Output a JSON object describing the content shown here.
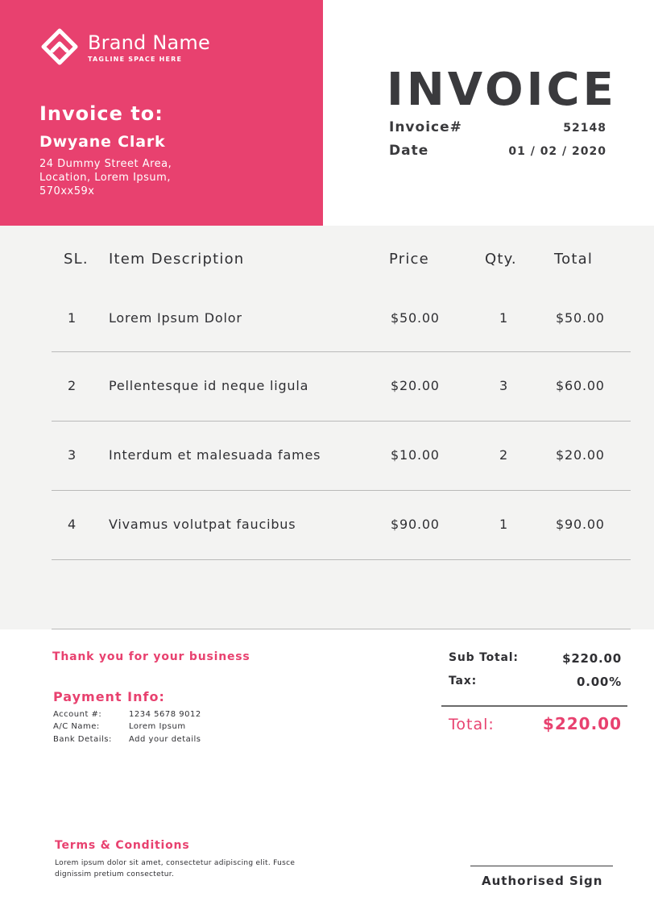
{
  "brand": {
    "name": "Brand Name",
    "tagline": "TAGLINE SPACE HERE"
  },
  "bill_to": {
    "label": "Invoice to:",
    "name": "Dwyane Clark",
    "address_lines": [
      "24 Dummy Street Area,",
      "Location, Lorem Ipsum,",
      "570xx59x"
    ]
  },
  "invoice": {
    "title": "INVOICE",
    "number_label": "Invoice#",
    "number": "52148",
    "date_label": "Date",
    "date": "01 / 02 / 2020"
  },
  "table": {
    "headers": {
      "sl": "SL.",
      "description": "Item Description",
      "price": "Price",
      "qty": "Qty.",
      "total": "Total"
    },
    "rows": [
      {
        "sl": "1",
        "description": "Lorem Ipsum Dolor",
        "price": "$50.00",
        "qty": "1",
        "total": "$50.00"
      },
      {
        "sl": "2",
        "description": "Pellentesque id neque ligula",
        "price": "$20.00",
        "qty": "3",
        "total": "$60.00"
      },
      {
        "sl": "3",
        "description": "Interdum et malesuada fames",
        "price": "$10.00",
        "qty": "2",
        "total": "$20.00"
      },
      {
        "sl": "4",
        "description": "Vivamus volutpat faucibus",
        "price": "$90.00",
        "qty": "1",
        "total": "$90.00"
      }
    ]
  },
  "thanks": "Thank you for your business",
  "payment": {
    "title": "Payment Info:",
    "rows": [
      {
        "label": "Account #:",
        "value": "1234 5678 9012"
      },
      {
        "label": "A/C Name:",
        "value": "Lorem Ipsum"
      },
      {
        "label": "Bank Details:",
        "value": "Add your details"
      }
    ]
  },
  "summary": {
    "subtotal_label": "Sub Total:",
    "subtotal": "$220.00",
    "tax_label": "Tax:",
    "tax": "0.00%",
    "total_label": "Total:",
    "total": "$220.00"
  },
  "terms": {
    "title": "Terms & Conditions",
    "text": "Lorem ipsum dolor sit amet, consectetur adipiscing elit. Fusce dignissim pretium consectetur."
  },
  "signature": {
    "label": "Authorised Sign"
  },
  "colors": {
    "accent": "#e8416f",
    "band": "#f3f3f2",
    "text": "#2f2f33"
  },
  "icons": {
    "brand_logo": "diamond-chevron-logo-icon"
  }
}
